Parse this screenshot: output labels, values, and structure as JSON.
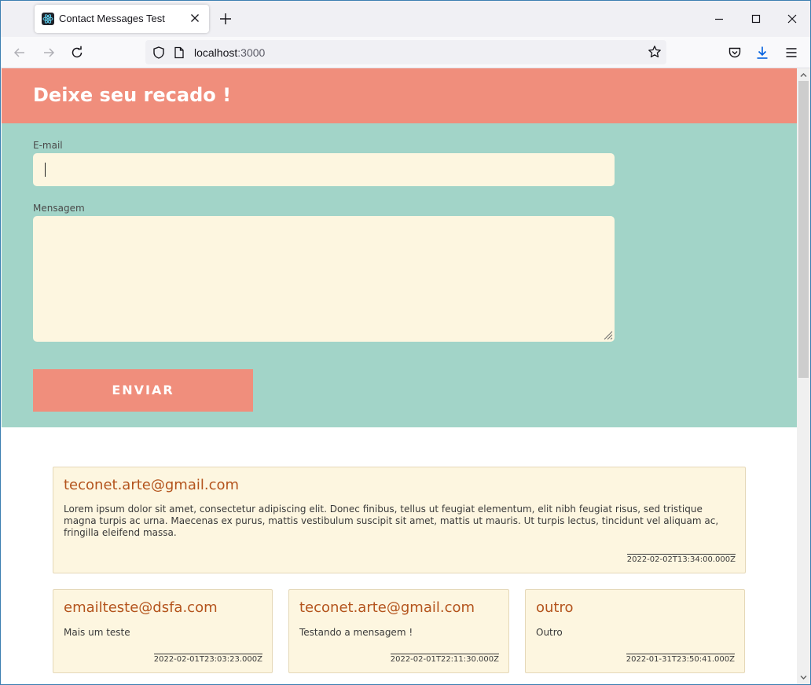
{
  "browser": {
    "tab_title": "Contact Messages Test",
    "url_host": "localhost",
    "url_port": ":3000"
  },
  "page": {
    "title": "Deixe seu recado !",
    "email_label": "E-mail",
    "email_value": "",
    "message_label": "Mensagem",
    "message_value": "",
    "submit_label": "ENVIAR"
  },
  "messages": [
    {
      "email": "teconet.arte@gmail.com",
      "text": "Lorem ipsum dolor sit amet, consectetur adipiscing elit. Donec finibus, tellus ut feugiat elementum, elit nibh feugiat risus, sed tristique magna turpis ac urna. Maecenas ex purus, mattis vestibulum suscipit sit amet, mattis ut mauris. Ut turpis lectus, tincidunt vel aliquam ac, fringilla eleifend massa.",
      "date": "2022-02-02T13:34:00.000Z"
    },
    {
      "email": "emailteste@dsfa.com",
      "text": "Mais um teste",
      "date": "2022-02-01T23:03:23.000Z"
    },
    {
      "email": "teconet.arte@gmail.com",
      "text": "Testando a mensagem !",
      "date": "2022-02-01T22:11:30.000Z"
    },
    {
      "email": "outro",
      "text": "Outro",
      "date": "2022-01-31T23:50:41.000Z"
    }
  ],
  "colors": {
    "header": "#f08e7c",
    "form_bg": "#a2d4c8",
    "input_bg": "#fdf6e0",
    "card_email": "#b4541d"
  }
}
